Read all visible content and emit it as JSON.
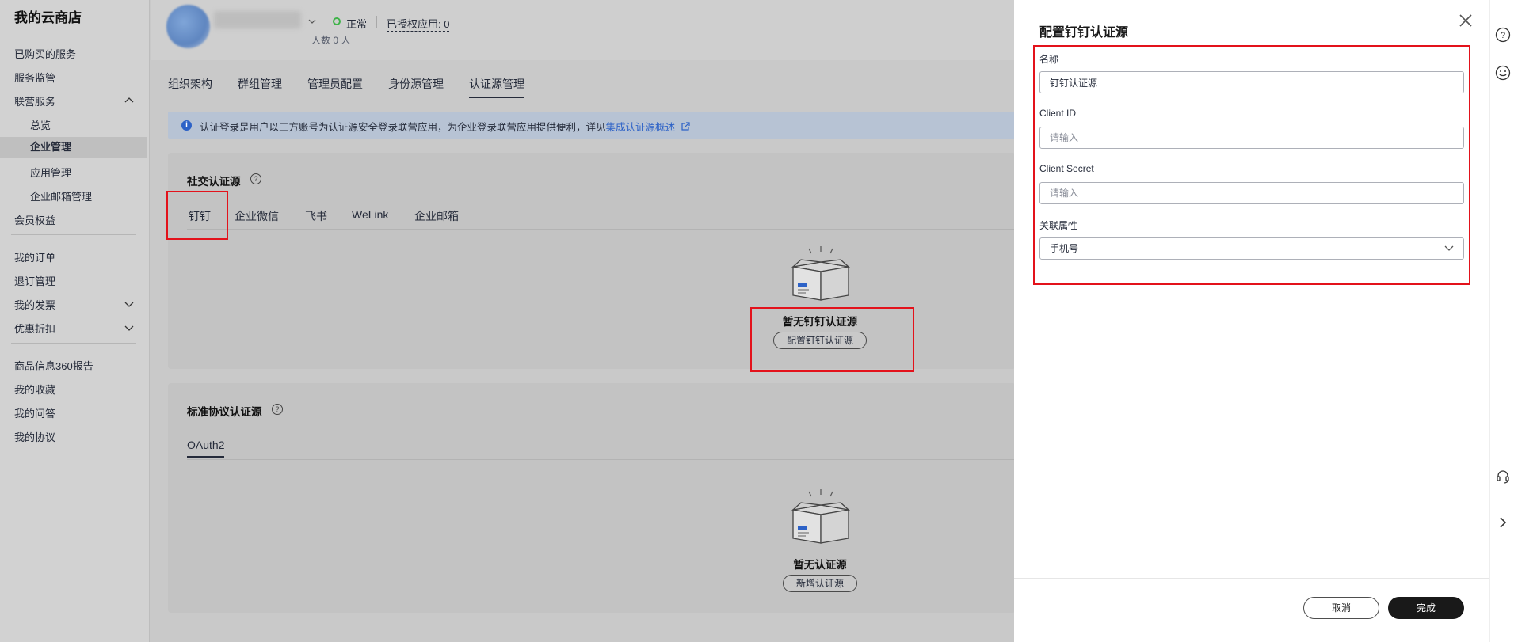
{
  "sidebar": {
    "title": "我的云商店",
    "items": [
      {
        "label": "已购买的服务"
      },
      {
        "label": "服务监管"
      },
      {
        "label": "联营服务"
      },
      {
        "label": "总览"
      },
      {
        "label": "企业管理"
      },
      {
        "label": "应用管理"
      },
      {
        "label": "企业邮箱管理"
      },
      {
        "label": "会员权益"
      },
      {
        "label": "我的订单"
      },
      {
        "label": "退订管理"
      },
      {
        "label": "我的发票"
      },
      {
        "label": "优惠折扣"
      },
      {
        "label": "商品信息360报告"
      },
      {
        "label": "我的收藏"
      },
      {
        "label": "我的问答"
      },
      {
        "label": "我的协议"
      }
    ]
  },
  "header": {
    "status": "正常",
    "authorized_apps": "已授权应用: 0",
    "people": "人数 0 人"
  },
  "tabs": [
    {
      "label": "组织架构"
    },
    {
      "label": "群组管理"
    },
    {
      "label": "管理员配置"
    },
    {
      "label": "身份源管理"
    },
    {
      "label": "认证源管理"
    }
  ],
  "notice": {
    "text": "认证登录是用户以三方账号为认证源安全登录联营应用，为企业登录联营应用提供便利，详见",
    "link": "集成认证源概述"
  },
  "social": {
    "title": "社交认证源",
    "tabs": [
      {
        "label": "钉钉"
      },
      {
        "label": "企业微信"
      },
      {
        "label": "飞书"
      },
      {
        "label": "WeLink"
      },
      {
        "label": "企业邮箱"
      }
    ],
    "empty_title": "暂无钉钉认证源",
    "empty_button": "配置钉钉认证源"
  },
  "standard": {
    "title": "标准协议认证源",
    "tabs": [
      {
        "label": "OAuth2"
      }
    ],
    "empty_title": "暂无认证源",
    "empty_button": "新增认证源"
  },
  "drawer": {
    "title": "配置钉钉认证源",
    "fields": {
      "name_label": "名称",
      "name_value": "钉钉认证源",
      "client_id_label": "Client ID",
      "client_id_placeholder": "请输入",
      "client_secret_label": "Client Secret",
      "client_secret_placeholder": "请输入",
      "attr_label": "关联属性",
      "attr_value": "手机号"
    },
    "cancel": "取消",
    "confirm": "完成"
  },
  "colors": {
    "accent": "#2d62c7",
    "highlight": "#e3121b",
    "primary_button": "#191919",
    "status_ok": "#3fb349"
  }
}
